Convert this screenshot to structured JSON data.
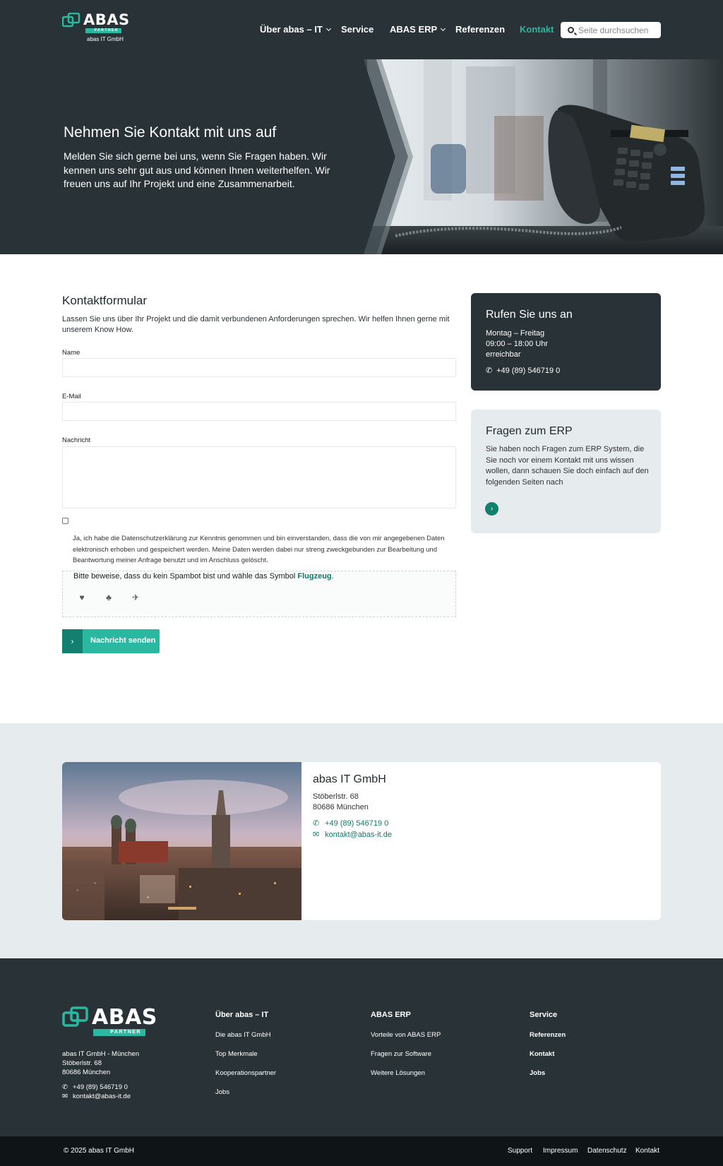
{
  "header": {
    "logo": {
      "name": "ABAS",
      "badge": "PARTNER",
      "sub": "abas IT GmbH"
    },
    "nav": [
      {
        "label": "Über abas – IT"
      },
      {
        "label": "Service"
      },
      {
        "label": "ABAS ERP"
      },
      {
        "label": "Referenzen"
      },
      {
        "label": "Kontakt"
      }
    ],
    "search": {
      "placeholder": "Seite durchsuchen"
    }
  },
  "hero": {
    "title": "Nehmen Sie Kontakt mit uns auf",
    "text": "Melden Sie sich gerne bei uns, wenn Sie Fragen haben. Wir kennen uns sehr gut aus und können Ihnen weiterhelfen. Wir freuen uns auf Ihr Projekt und eine Zusammenarbeit."
  },
  "form": {
    "title": "Kontaktformular",
    "intro": "Lassen Sie uns über Ihr Projekt und die damit verbundenen Anforderungen sprechen. Wir helfen Ihnen gerne mit unserem Know How.",
    "name_label": "Name",
    "name_value": "",
    "email_label": "E-Mail",
    "email_value": "",
    "message_label": "Nachricht",
    "message_value": "",
    "privacy_text": "Ja, ich habe die Datenschutzerklärung zur Kenntnis genommen und bin einverstanden, dass die von mir angegebenen Daten elektronisch erhoben und gespeichert werden. Meine Daten werden dabei nur streng zweckgebunden zur Bearbeitung und Beantwortung meiner Anfrage benutzt und im Anschluss gelöscht.",
    "captcha_text": "Bitte beweise, dass du kein Spambot bist und wähle das Symbol",
    "captcha_target": "Flugzeug",
    "captcha_icons": [
      "heart-icon",
      "tree-icon",
      "plane-icon"
    ],
    "submit_label": "Nachricht senden"
  },
  "call_box": {
    "title": "Rufen Sie uns an",
    "days": "Montag – Freitag",
    "hours": "09:00 – 18:00 Uhr",
    "reach": "erreichbar",
    "phone": "+49 (89) 546719 0"
  },
  "erp_box": {
    "title": "Fragen zum ERP",
    "text": "Sie haben noch Fragen zum ERP System, die Sie noch vor einem Kontakt mit uns wissen wollen, dann schauen Sie doch einfach auf den folgenden Seiten nach"
  },
  "address": {
    "company": "abas IT GmbH",
    "street": "Stöberlstr. 68",
    "city": "80686 München",
    "phone": "+49 (89) 546719 0",
    "email": "kontakt@abas-it.de"
  },
  "footer": {
    "company_line": "abas IT GmbH - München",
    "street": "Stöberlstr. 68",
    "city": "80686 München",
    "phone": "+49 (89) 546719 0",
    "email": "kontakt@abas-it.de",
    "col1": {
      "title": "Über abas – IT",
      "links": [
        "Die abas IT GmbH",
        "Top Merkmale",
        "Kooperationspartner",
        "Jobs"
      ]
    },
    "col2": {
      "title": "ABAS ERP",
      "links": [
        "Vorteile von ABAS ERP",
        "Fragen zur Software",
        "Weitere Lösungen"
      ]
    },
    "col3": {
      "title": "Service",
      "links": [
        "Referenzen",
        "Kontakt",
        "Jobs"
      ]
    },
    "copyright": "© 2025 abas IT GmbH",
    "bottom_links": [
      "Support",
      "Impressum",
      "Datenschutz",
      "Kontakt"
    ]
  },
  "colors": {
    "dark": "#293236",
    "accent": "#2ab9a0",
    "accent_dark": "#12806f",
    "light_bg": "#e6ebed",
    "bottom_bar": "#0f1416"
  }
}
